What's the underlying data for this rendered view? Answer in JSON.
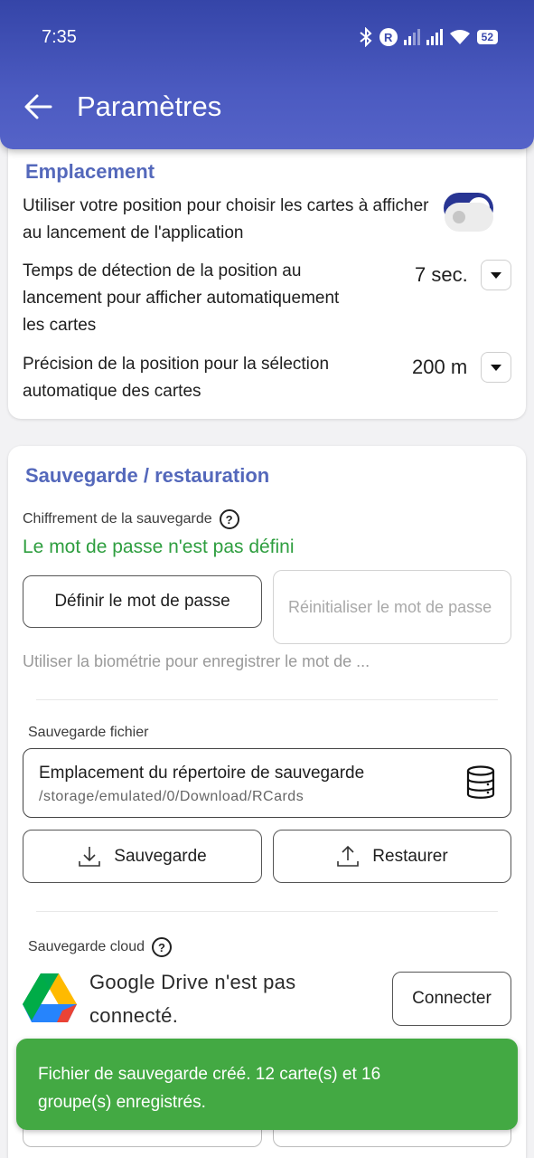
{
  "status_bar": {
    "time": "7:35",
    "battery": "52"
  },
  "app_bar": {
    "title": "Paramètres"
  },
  "location": {
    "section_title": "Emplacement",
    "use_position_text": "Utiliser votre position pour choisir les cartes à afficher au lancement de l'application",
    "use_position_enabled": true,
    "detection_time": {
      "line1": "Temps de détection de la position au",
      "line2": "lancement pour afficher automatiquement",
      "line3": "les cartes",
      "value": "7 sec."
    },
    "precision": {
      "line1": "Précision de la position pour la sélection",
      "line2": "automatique des cartes",
      "value": "200 m"
    }
  },
  "backup": {
    "section_title": "Sauvegarde / restauration",
    "encryption_label": "Chiffrement de la sauvegarde",
    "password_status": "Le mot de passe n'est pas défini",
    "set_password_button": "Définir le mot de passe",
    "reset_password_button": "Réinitialiser le mot de passe",
    "biometric_text": "Utiliser la biométrie pour enregistrer le mot de ...",
    "biometric_enabled": false,
    "file_label": "Sauvegarde fichier",
    "directory_title": "Emplacement du répertoire de sauvegarde",
    "directory_path": "/storage/emulated/0/Download/RCards",
    "save_button": "Sauvegarde",
    "restore_button": "Restaurer",
    "cloud_label": "Sauvegarde cloud",
    "gdrive_status_line1": "Google Drive n'est pas",
    "gdrive_status_line2": "connecté.",
    "connect_button": "Connecter"
  },
  "snackbar": {
    "line1": "Fichier de sauvegarde créé. 12 carte(s) et 16",
    "line2": "groupe(s) enregistrés."
  },
  "colors": {
    "primary": "#3545a8",
    "section_title": "#5468bb",
    "success": "#43a943",
    "status_green": "#2e9e3f"
  }
}
